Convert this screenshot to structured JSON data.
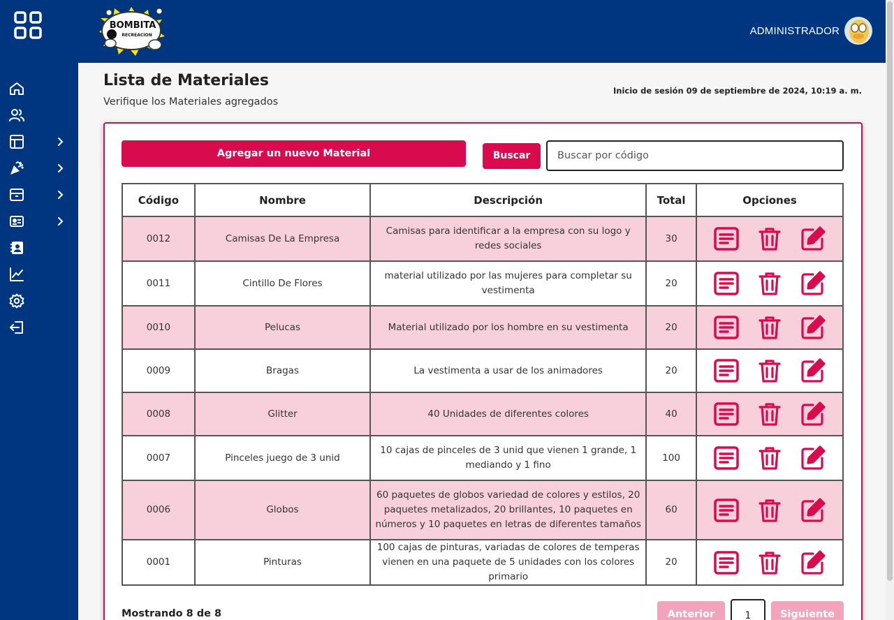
{
  "colors": {
    "navy": "#003580",
    "accent": "#d90a4e",
    "row_alt": "#f8d0dc",
    "disabled": "#f4a3bd"
  },
  "header": {
    "logo_text_top": "BOMBITA",
    "logo_text_bottom": "RECREACION",
    "user_name": "ADMINISTRADOR"
  },
  "sidebar": {
    "items": [
      {
        "icon": "home-icon"
      },
      {
        "icon": "users-icon"
      },
      {
        "icon": "layout-icon",
        "has_submenu": true
      },
      {
        "icon": "party-icon",
        "has_submenu": true
      },
      {
        "icon": "archive-icon",
        "has_submenu": true
      },
      {
        "icon": "id-card-icon",
        "has_submenu": true
      },
      {
        "icon": "contacts-icon"
      },
      {
        "icon": "chart-icon"
      },
      {
        "icon": "settings-icon"
      },
      {
        "icon": "logout-icon"
      }
    ]
  },
  "page": {
    "title": "Lista de Materiales",
    "subtitle": "Verifique los Materiales agregados",
    "session": "Inicio de sesión 09 de septiembre de 2024, 10:19 a. m."
  },
  "toolbar": {
    "add_label": "Agregar un nuevo Material",
    "search_label": "Buscar",
    "search_placeholder": "Buscar por código",
    "search_value": ""
  },
  "table": {
    "headers": [
      "Código",
      "Nombre",
      "Descripción",
      "Total",
      "Opciones"
    ],
    "rows": [
      {
        "code": "0012",
        "name": "Camisas De La Empresa",
        "desc": "Camisas para identificar a la empresa con su logo y redes sociales",
        "total": "30"
      },
      {
        "code": "0011",
        "name": "Cintillo De Flores",
        "desc": "material utilizado por las mujeres para completar su vestimenta",
        "total": "20"
      },
      {
        "code": "0010",
        "name": "Pelucas",
        "desc": "Material utilizado por los hombre en su vestimenta",
        "total": "20"
      },
      {
        "code": "0009",
        "name": "Bragas",
        "desc": "La vestimenta a usar de los animadores",
        "total": "20"
      },
      {
        "code": "0008",
        "name": "Glitter",
        "desc": "40 Unidades de diferentes colores",
        "total": "40"
      },
      {
        "code": "0007",
        "name": "Pinceles juego de 3 unid",
        "desc": "10 cajas de pinceles de 3 unid que vienen 1 grande, 1 mediando y 1 fino",
        "total": "100"
      },
      {
        "code": "0006",
        "name": "Globos",
        "desc": "60 paquetes de globos variedad de colores y estilos, 20 paquetes metalizados, 20 brillantes, 10 paquetes en números y 10 paquetes en letras de diferentes tamaños",
        "total": "60"
      },
      {
        "code": "0001",
        "name": "Pinturas",
        "desc": "100 cajas de pinturas, variadas de colores de temperas vienen en una paquete de 5 unidades con los colores primario",
        "total": "20"
      }
    ]
  },
  "footer": {
    "showing": "Mostrando 8 de 8",
    "prev_label": "Anterior",
    "page": "1",
    "next_label": "Siguiente"
  }
}
